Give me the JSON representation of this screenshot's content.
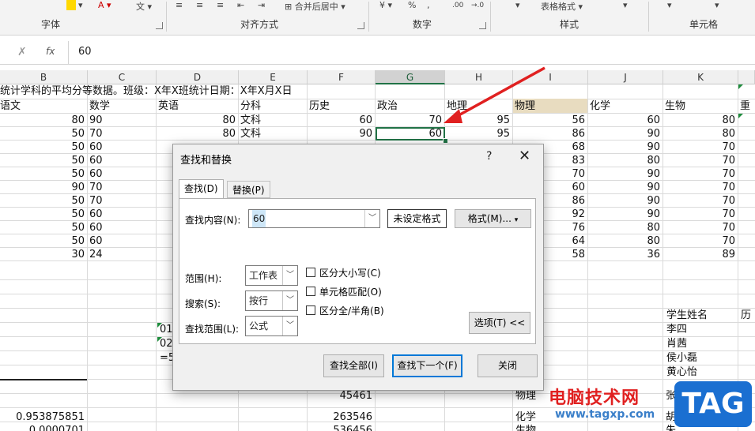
{
  "ribbon": {
    "groups": [
      "字体",
      "对齐方式",
      "数字",
      "样式",
      "单元格"
    ],
    "merge_label": "合并后居中",
    "table_format": "表格格式",
    "percent": "%",
    "decimal": ".00",
    "decimal2": "→.0"
  },
  "formula_bar": {
    "value": "60",
    "fx": "fx",
    "confirm": "✓",
    "cancel": "✗"
  },
  "columns": [
    "B",
    "C",
    "D",
    "E",
    "F",
    "G",
    "H",
    "I",
    "J",
    "K"
  ],
  "selected_column": "G",
  "sheet": {
    "row1_text": "统计学科的平均分等数据。班级：X年X班统计日期：X年X月X日",
    "headers": [
      "语文",
      "数学",
      "英语",
      "分科",
      "历史",
      "政治",
      "地理",
      "物理",
      "化学",
      "生物",
      "重"
    ],
    "rows": [
      [
        "80",
        "90",
        "80",
        "文科",
        "60",
        "70",
        "95",
        "56",
        "60",
        "80"
      ],
      [
        "50",
        "70",
        "80",
        "文科",
        "90",
        "60",
        "95",
        "86",
        "90",
        "80"
      ],
      [
        "50",
        "60",
        "",
        "",
        "",
        "",
        "",
        "68",
        "90",
        "70"
      ],
      [
        "50",
        "60",
        "",
        "",
        "",
        "",
        "",
        "83",
        "80",
        "70"
      ],
      [
        "50",
        "60",
        "",
        "",
        "",
        "",
        "",
        "70",
        "90",
        "70"
      ],
      [
        "90",
        "70",
        "",
        "",
        "",
        "",
        "",
        "60",
        "90",
        "70"
      ],
      [
        "50",
        "70",
        "",
        "",
        "",
        "",
        "",
        "86",
        "90",
        "70"
      ],
      [
        "50",
        "60",
        "",
        "",
        "",
        "",
        "",
        "92",
        "90",
        "70"
      ],
      [
        "50",
        "60",
        "",
        "",
        "",
        "",
        "",
        "76",
        "80",
        "70"
      ],
      [
        "50",
        "60",
        "",
        "",
        "",
        "",
        "",
        "64",
        "80",
        "70"
      ],
      [
        "30",
        "24",
        "",
        "",
        "",
        "",
        "",
        "58",
        "36",
        "89"
      ]
    ],
    "side_header": "学生姓名",
    "side_header2": "历",
    "names": [
      "李四",
      "肖茜",
      "侯小磊",
      "黄心怡"
    ],
    "d_partial": [
      "01",
      "02",
      "=5"
    ],
    "bottom": {
      "b1": "0.953875851",
      "b2": "0.0000701",
      "f1": "45461",
      "f2": "263546",
      "f3": "536456",
      "i1": "物理",
      "i2": "化学",
      "i3": "生物",
      "k1": "张",
      "k2": "胡",
      "k3": "朱"
    }
  },
  "dialog": {
    "title": "查找和替换",
    "help": "?",
    "close": "✕",
    "tabs": [
      "查找(D)",
      "替换(P)"
    ],
    "find_label": "查找内容(N):",
    "find_value": "60",
    "no_format": "未设定格式",
    "format_btn": "格式(M)...",
    "scope_label": "范围(H):",
    "scope_value": "工作表",
    "search_label": "搜索(S):",
    "search_value": "按行",
    "lookin_label": "查找范围(L):",
    "lookin_value": "公式",
    "checkboxes": [
      "区分大小写(C)",
      "单元格匹配(O)",
      "区分全/半角(B)"
    ],
    "options_btn": "选项(T) <<",
    "find_all": "查找全部(I)",
    "find_next": "查找下一个(F)",
    "close_btn": "关闭"
  },
  "watermark": {
    "text": "电脑技术网",
    "url": "www.tagxp.com",
    "logo": "TAG"
  },
  "colors": {
    "accent": "#217346",
    "physics_highlight": "#e8dcc0",
    "arrow": "#e02020"
  }
}
